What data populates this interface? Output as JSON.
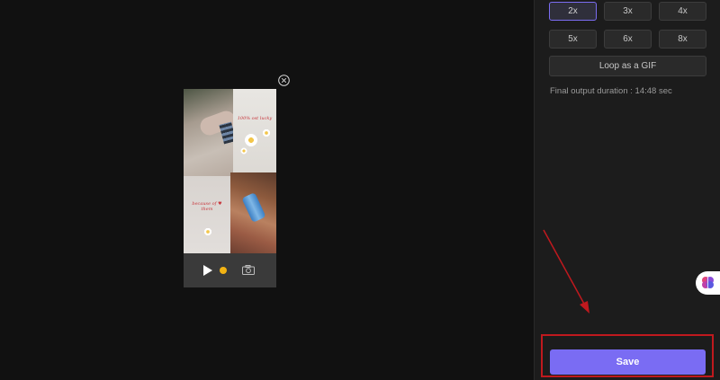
{
  "preview": {
    "collage_text_top": "100% ost lucky",
    "collage_text_bottom": "because of ♥ them"
  },
  "panel": {
    "speed_options": [
      {
        "label": "2x",
        "selected": true
      },
      {
        "label": "3x",
        "selected": false
      },
      {
        "label": "4x",
        "selected": false
      },
      {
        "label": "5x",
        "selected": false
      },
      {
        "label": "6x",
        "selected": false
      },
      {
        "label": "8x",
        "selected": false
      }
    ],
    "loop_label": "Loop as a GIF",
    "duration_text": "Final output duration : 14:48 sec",
    "save_label": "Save"
  },
  "colors": {
    "accent": "#7a6cf3",
    "highlight": "#c0191e",
    "background": "#111111",
    "panel": "#1c1c1c"
  },
  "icons": [
    "play-icon",
    "record-dot-icon",
    "camera-icon",
    "close-icon",
    "brain-icon"
  ]
}
